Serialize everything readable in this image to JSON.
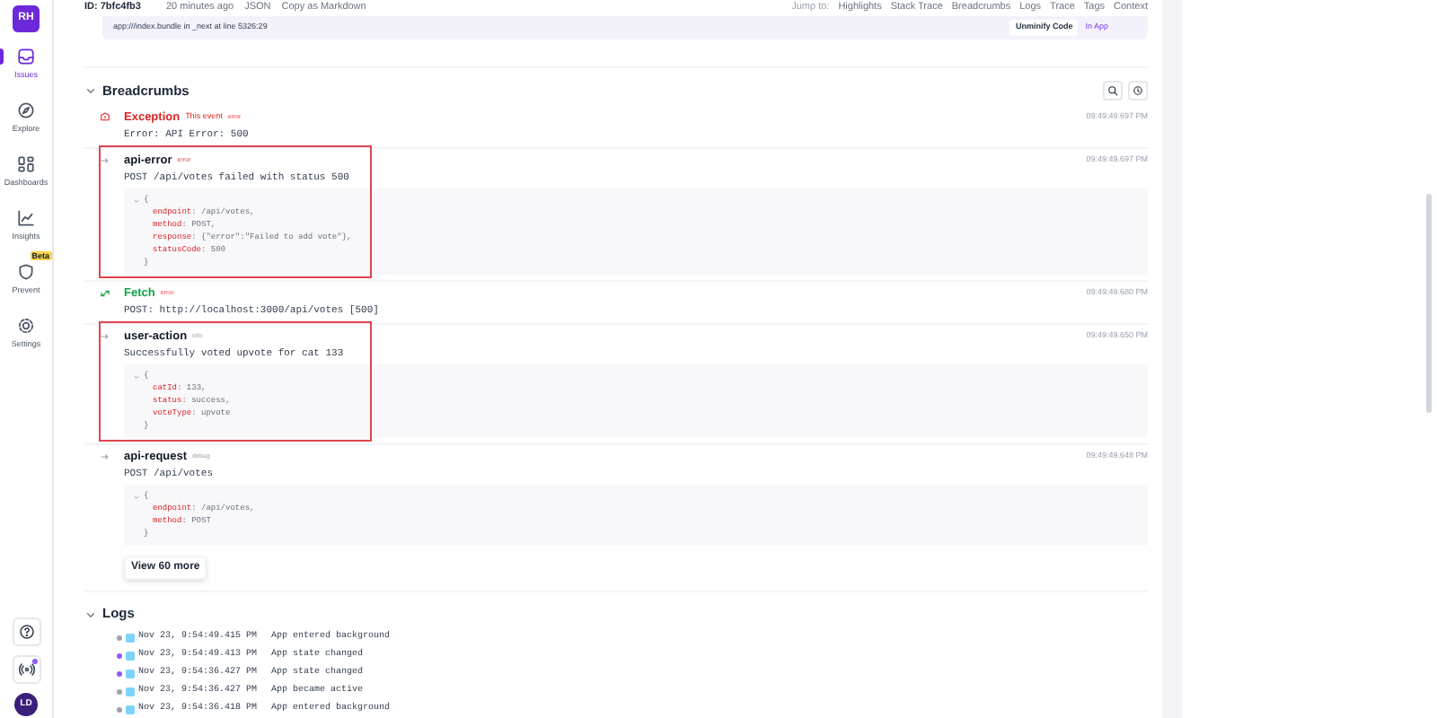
{
  "sidebar": {
    "avatar": "RH",
    "items": [
      {
        "label": "Issues",
        "selected": true
      },
      {
        "label": "Explore",
        "selected": false
      },
      {
        "label": "Dashboards",
        "selected": false
      },
      {
        "label": "Insights",
        "selected": false
      },
      {
        "label": "Prevent",
        "selected": false,
        "badge": "Beta"
      },
      {
        "label": "Settings",
        "selected": false
      }
    ],
    "user_avatar": "LD"
  },
  "header": {
    "id": "ID: 7bfc4fb3",
    "time": "20 minutes ago",
    "actions": [
      "JSON",
      "Copy as Markdown"
    ],
    "jump_label": "Jump to:",
    "jump_links": [
      "Highlights",
      "Stack Trace",
      "Breadcrumbs",
      "Logs",
      "Trace",
      "Tags",
      "Context"
    ]
  },
  "frame": {
    "text": "app:///index.bundle in _next at line 5326:29",
    "unminify": "Unminify Code",
    "in_app": "In App"
  },
  "breadcrumbs": {
    "title": "Breadcrumbs",
    "expanded": true,
    "items": [
      {
        "kind": "exception",
        "title": "Exception",
        "tag": "This event",
        "severity": "error",
        "time": "09:49:49.697 PM",
        "message": "Error: API Error: 500",
        "highlighted": false
      },
      {
        "kind": "default",
        "title": "api-error",
        "severity": "error",
        "time": "09:49:49.697 PM",
        "message": "POST /api/votes failed with status 500",
        "highlighted": true,
        "data_open": "{",
        "data_close": "}",
        "data": [
          {
            "key": "endpoint",
            "value": ": /api/votes,"
          },
          {
            "key": "method",
            "value": ": POST,"
          },
          {
            "key": "response",
            "value": ": {\"error\":\"Failed to add vote\"},"
          },
          {
            "key": "statusCode",
            "value": ": 500"
          }
        ]
      },
      {
        "kind": "http",
        "title": "Fetch",
        "severity": "error",
        "time": "09:49:49.680 PM",
        "message": "POST: http://localhost:3000/api/votes [500]",
        "highlighted": false
      },
      {
        "kind": "default",
        "title": "user-action",
        "severity": "info",
        "time": "09:49:49.650 PM",
        "message": "Successfully voted upvote for cat 133",
        "highlighted": true,
        "data_open": "{",
        "data_close": "}",
        "data": [
          {
            "key": "catId",
            "value": ": 133,"
          },
          {
            "key": "status",
            "value": ": success,"
          },
          {
            "key": "voteType",
            "value": ": upvote"
          }
        ]
      },
      {
        "kind": "default",
        "title": "api-request",
        "severity": "debug",
        "time": "09:49:49.648 PM",
        "message": "POST /api/votes",
        "highlighted": false,
        "data_open": "{",
        "data_close": "}",
        "data": [
          {
            "key": "endpoint",
            "value": ": /api/votes,"
          },
          {
            "key": "method",
            "value": ": POST"
          }
        ]
      }
    ],
    "more": "View 60 more"
  },
  "logs": {
    "title": "Logs",
    "expanded": true,
    "rows": [
      {
        "color": "#9ca3af",
        "time": "Nov 23, 9:54:49.415 PM",
        "message": "App entered background"
      },
      {
        "color": "#8b5cf6",
        "time": "Nov 23, 9:54:49.413 PM",
        "message": "App state changed"
      },
      {
        "color": "#8b5cf6",
        "time": "Nov 23, 9:54:36.427 PM",
        "message": "App state changed"
      },
      {
        "color": "#9ca3af",
        "time": "Nov 23, 9:54:36.427 PM",
        "message": "App became active"
      },
      {
        "color": "#9ca3af",
        "time": "Nov 23, 9:54:36.418 PM",
        "message": "App entered background"
      }
    ]
  }
}
